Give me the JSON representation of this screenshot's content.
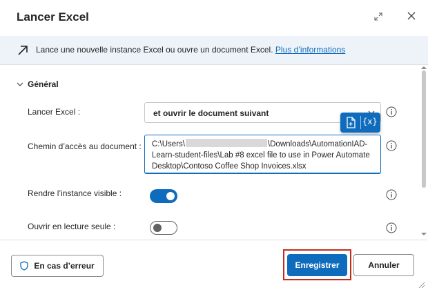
{
  "dialog": {
    "title": "Lancer Excel"
  },
  "info": {
    "text": "Lance une nouvelle instance Excel ou ouvre un document Excel.",
    "link": "Plus d’informations"
  },
  "section": {
    "title": "Général"
  },
  "fields": {
    "launch": {
      "label": "Lancer Excel :",
      "value": "et ouvrir le document suivant"
    },
    "path": {
      "label": "Chemin d’accès au document :",
      "value_prefix": "C:\\Users\\",
      "value_suffix": "\\Downloads\\AutomationIAD-Learn-student-files\\Lab #8 excel file to use in Power Automate Desktop\\Contoso Coffee Shop Invoices.xlsx"
    },
    "visible": {
      "label": "Rendre l’instance visible :",
      "state": "on"
    },
    "readonly": {
      "label": "Ouvrir en lecture seule :",
      "state": "off"
    }
  },
  "variable_popup": {
    "var_label": "{x}"
  },
  "footer": {
    "error_button": "En cas d’erreur",
    "save_button": "Enregistrer",
    "cancel_button": "Annuler"
  },
  "colors": {
    "accent": "#0f6cbd",
    "highlight": "#c42b1c",
    "banner": "#eef3fa"
  }
}
